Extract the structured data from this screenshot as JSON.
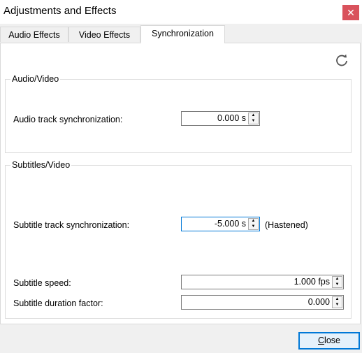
{
  "window": {
    "title": "Adjustments and Effects",
    "close_glyph": "✕"
  },
  "tabs": [
    {
      "label": "Audio Effects",
      "active": false
    },
    {
      "label": "Video Effects",
      "active": false
    },
    {
      "label": "Synchronization",
      "active": true
    }
  ],
  "toolbar": {
    "reset_icon": "refresh-icon",
    "reset_glyph": "⟳"
  },
  "audio_video": {
    "title": "Audio/Video",
    "audio_sync_label": "Audio track synchronization:",
    "audio_sync_value": "0.000 s"
  },
  "subtitles_video": {
    "title": "Subtitles/Video",
    "subtitle_sync_label": "Subtitle track synchronization:",
    "subtitle_sync_value": "-5.000 s",
    "subtitle_sync_note": "(Hastened)",
    "subtitle_speed_label": "Subtitle speed:",
    "subtitle_speed_value": "1.000 fps",
    "subtitle_duration_label": "Subtitle duration factor:",
    "subtitle_duration_value": "0.000"
  },
  "footer": {
    "close_label": "Close",
    "close_mnemonic": "C"
  },
  "colors": {
    "accent": "#0078d7",
    "titlebar_close": "#d9525c"
  }
}
